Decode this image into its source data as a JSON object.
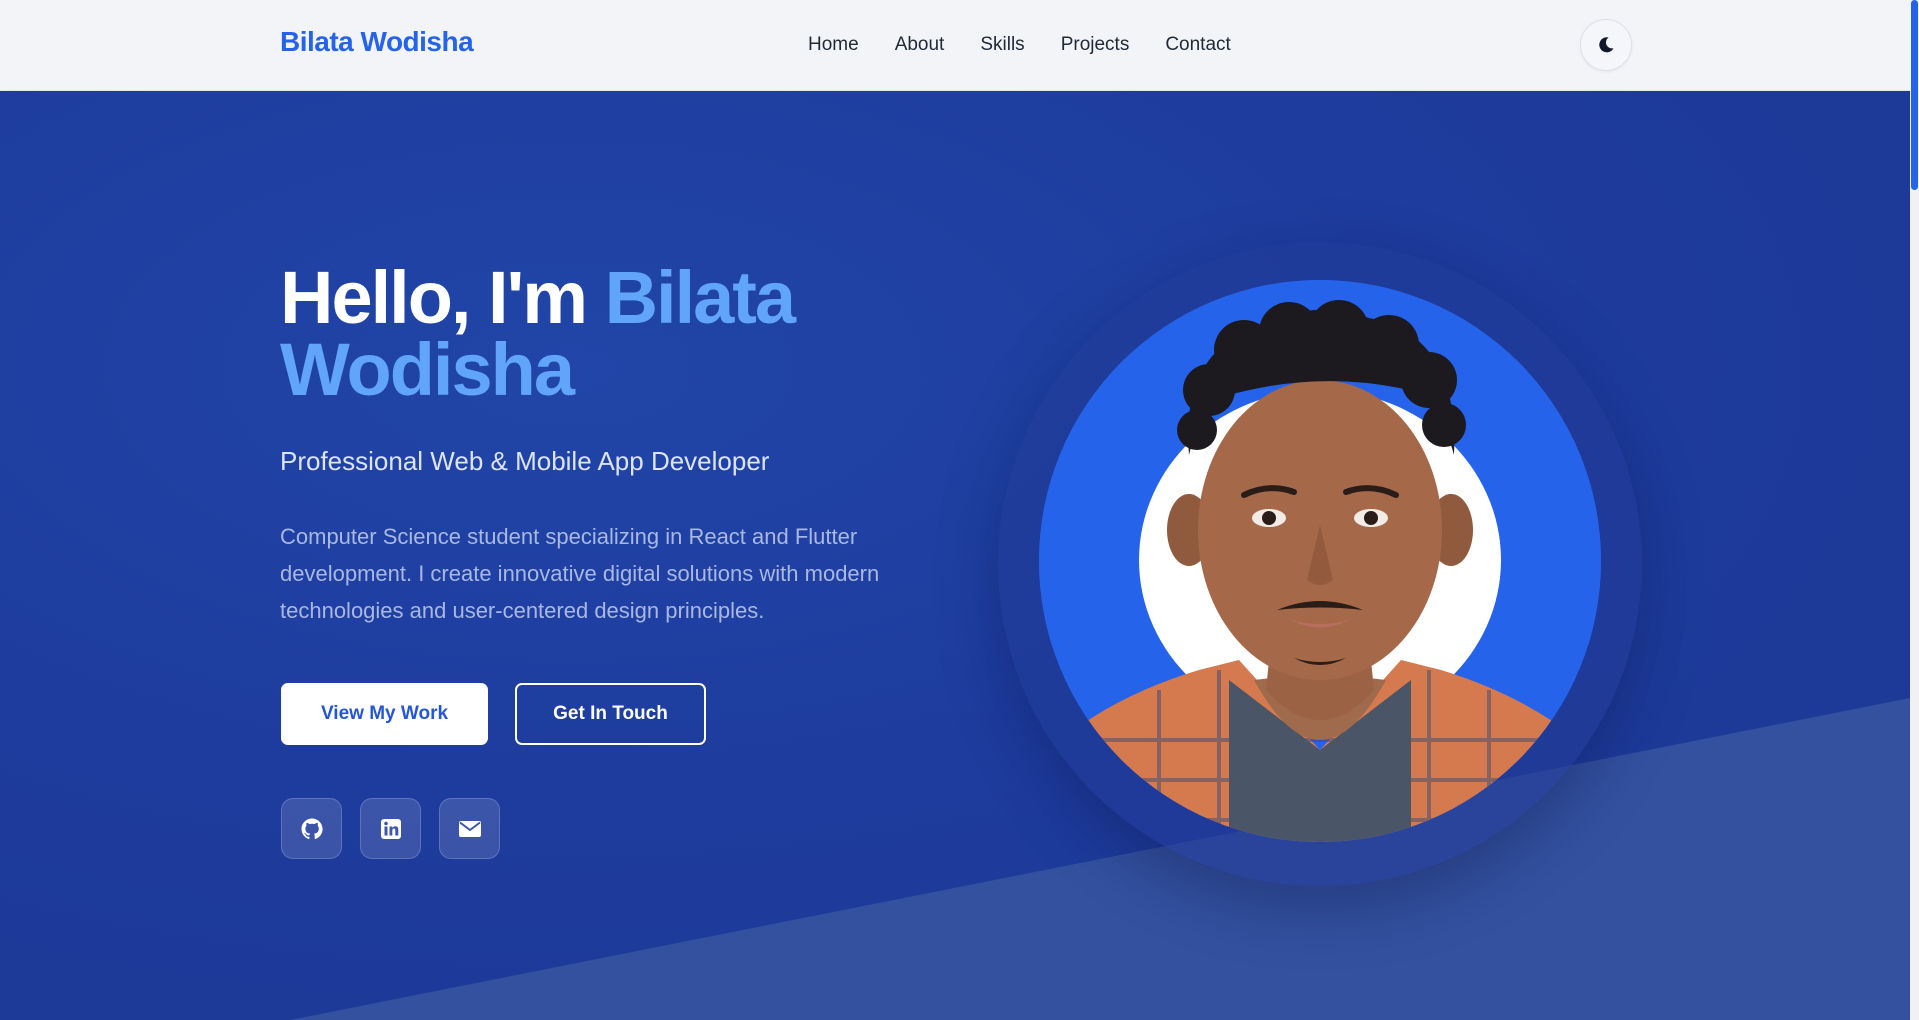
{
  "navbar": {
    "brand": "Bilata Wodisha",
    "links": [
      "Home",
      "About",
      "Skills",
      "Projects",
      "Contact"
    ],
    "theme_toggle_icon": "moon-icon"
  },
  "hero": {
    "greeting": "Hello, I'm",
    "name_line1": "Bilata",
    "name_line2": "Wodisha",
    "subtitle": "Professional Web & Mobile App Developer",
    "description": "Computer Science student specializing in React and Flutter development. I create innovative digital solutions with modern technologies and user-centered design principles.",
    "primary_button": "View My Work",
    "secondary_button": "Get In Touch",
    "social_icons": [
      "github-icon",
      "linkedin-icon",
      "email-icon"
    ]
  },
  "colors": {
    "brand": "#2563eb",
    "hero_background": "#1e3a9f",
    "accent_name": "#60a5fa",
    "nav_background": "#f3f4f8"
  }
}
